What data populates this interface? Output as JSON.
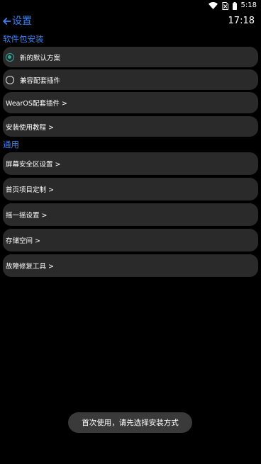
{
  "status_bar": {
    "time": "5:18",
    "icons": [
      "wifi-icon",
      "no-sim-icon",
      "battery-icon"
    ]
  },
  "header": {
    "back_label": "设置",
    "clock": "17:18"
  },
  "package_section": {
    "title": "软件包安装",
    "options": [
      {
        "label": "新的默认方案",
        "selected": true
      },
      {
        "label": "兼容配套插件",
        "selected": false
      }
    ],
    "links": [
      {
        "label": "WearOS配套插件 >"
      },
      {
        "label": "安装使用教程 >"
      }
    ]
  },
  "general_section": {
    "title": "通用",
    "links": [
      {
        "label": "屏幕安全区设置 >"
      },
      {
        "label": "首页项目定制 >"
      },
      {
        "label": "摇一摇设置 >"
      },
      {
        "label": "存储空间 >"
      },
      {
        "label": "故障修复工具 >"
      }
    ]
  },
  "toast": {
    "message": "首次使用，请先选择安装方式"
  },
  "colors": {
    "accent": "#3b82f6",
    "radio_checked": "#2fa89a",
    "row_background": "#2a2a2a",
    "background": "#000000"
  }
}
